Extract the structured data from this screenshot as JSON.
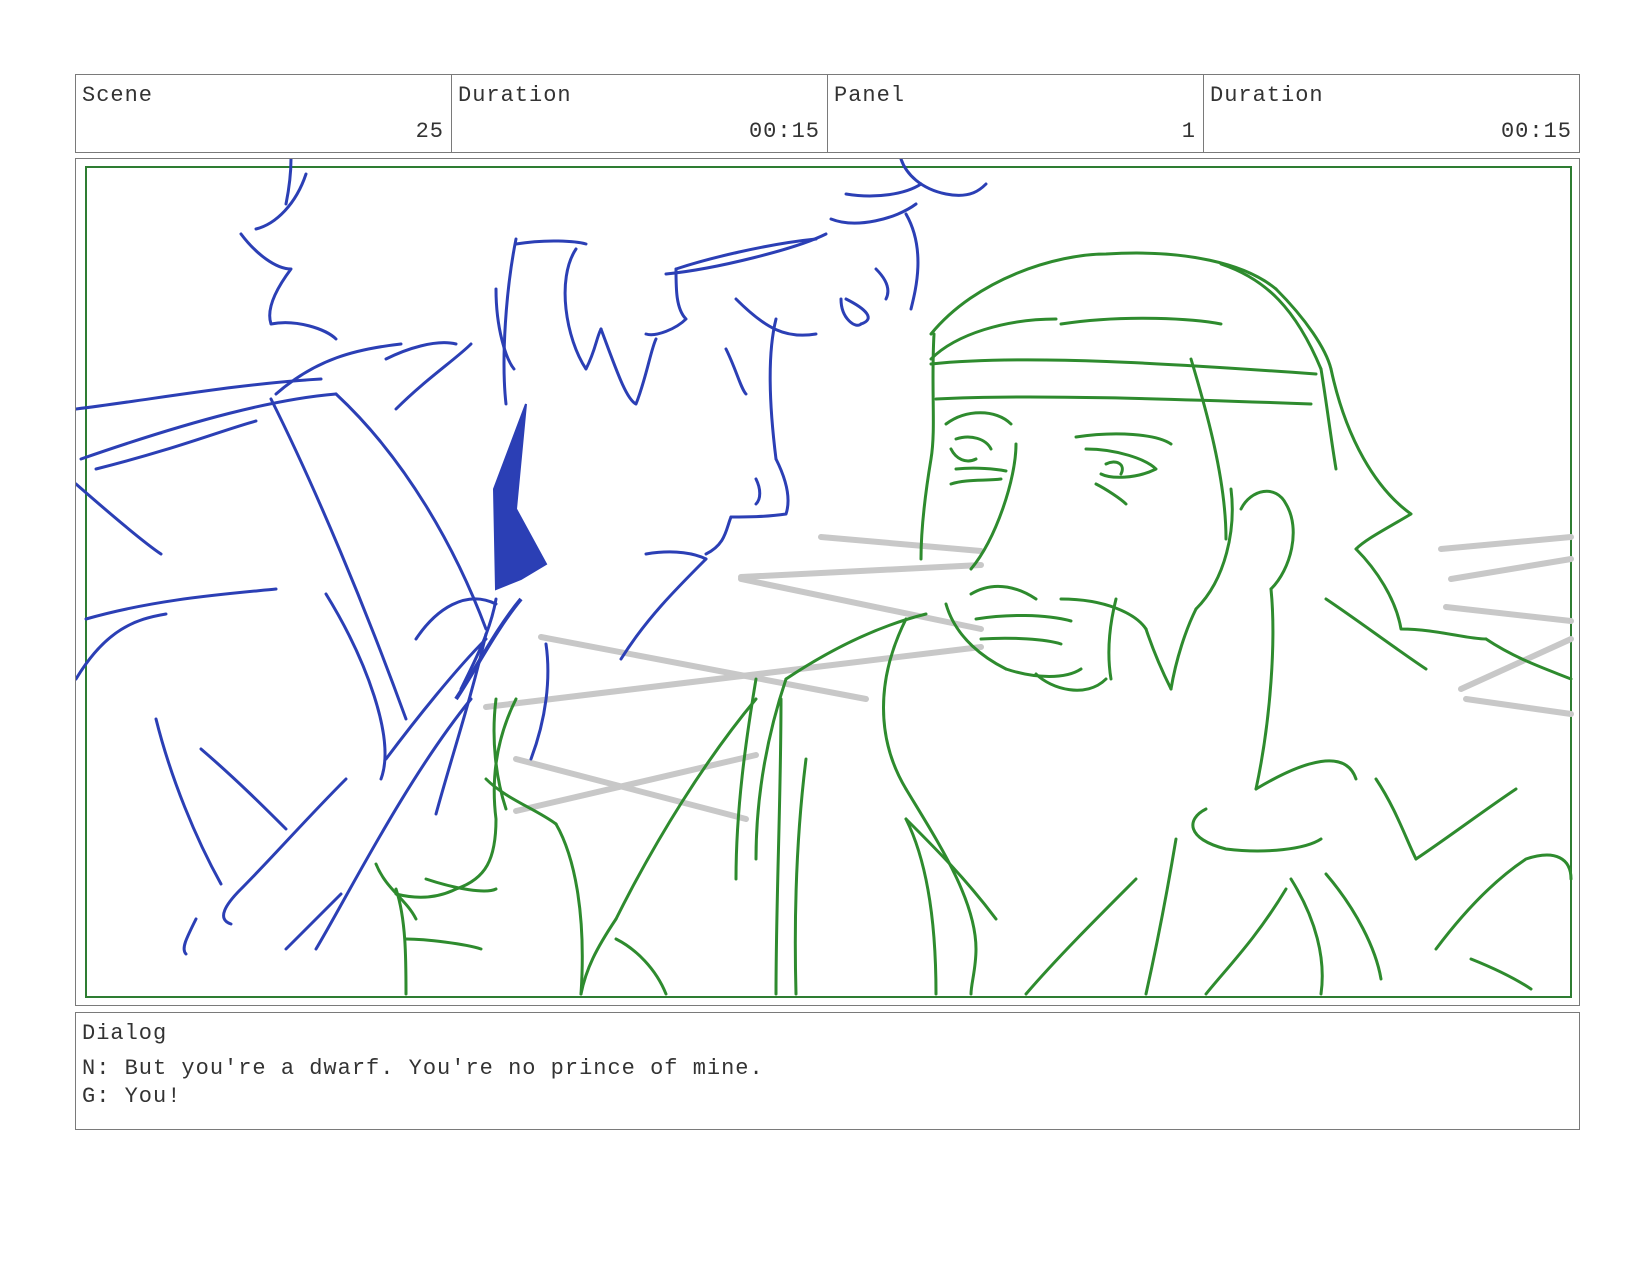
{
  "header": {
    "cells": [
      {
        "label": "Scene",
        "value": "25"
      },
      {
        "label": "Duration",
        "value": "00:15"
      },
      {
        "label": "Panel",
        "value": "1"
      },
      {
        "label": "Duration",
        "value": "00:15"
      }
    ]
  },
  "panel": {
    "border_color": "#2e7d32",
    "character_left_color": "#2b3fb5",
    "character_right_color": "#2e8b2e",
    "background_lines_color": "#c8c8c8"
  },
  "dialog": {
    "label": "Dialog",
    "lines": [
      "N: But you're a dwarf. You're no prince of mine.",
      "G: You!"
    ]
  }
}
